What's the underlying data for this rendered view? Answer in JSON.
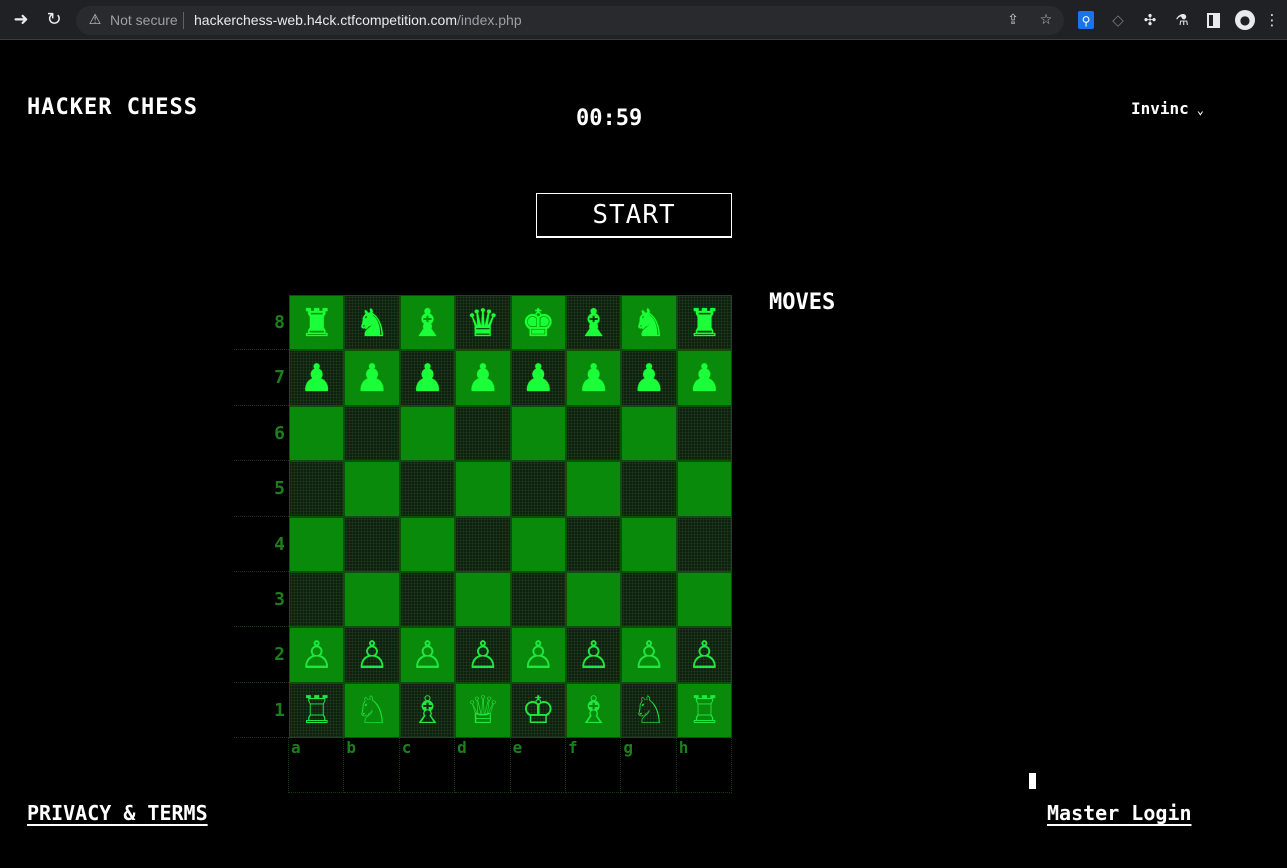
{
  "browser": {
    "security_label": "Not secure",
    "url_host": "hackerchess-web.h4ck.ctfcompetition.com",
    "url_path": "/index.php"
  },
  "header": {
    "title": "HACKER CHESS",
    "timer": "00:59",
    "user": "Invinc"
  },
  "start_label": "START",
  "moves_title": "MOVES",
  "board": {
    "ranks": [
      "8",
      "7",
      "6",
      "5",
      "4",
      "3",
      "2",
      "1"
    ],
    "files": [
      "a",
      "b",
      "c",
      "d",
      "e",
      "f",
      "g",
      "h"
    ],
    "rows": [
      [
        "r",
        "n",
        "b",
        "q",
        "k",
        "b",
        "n",
        "r"
      ],
      [
        "p",
        "p",
        "p",
        "p",
        "p",
        "p",
        "p",
        "p"
      ],
      [
        "",
        "",
        "",
        "",
        "",
        "",
        "",
        ""
      ],
      [
        "",
        "",
        "",
        "",
        "",
        "",
        "",
        ""
      ],
      [
        "",
        "",
        "",
        "",
        "",
        "",
        "",
        ""
      ],
      [
        "",
        "",
        "",
        "",
        "",
        "",
        "",
        ""
      ],
      [
        "P",
        "P",
        "P",
        "P",
        "P",
        "P",
        "P",
        "P"
      ],
      [
        "R",
        "N",
        "B",
        "Q",
        "K",
        "B",
        "N",
        "R"
      ]
    ]
  },
  "footer": {
    "privacy": "PRIVACY & TERMS",
    "master_login": "Master Login"
  },
  "icons": {
    "back": "arrow-right-icon",
    "reload": "reload-icon"
  },
  "colors": {
    "light_square": "#0a8a0a",
    "dark_square": "#0f200f",
    "piece_green": "#1bff3a",
    "label_green": "#1c7f1c"
  }
}
